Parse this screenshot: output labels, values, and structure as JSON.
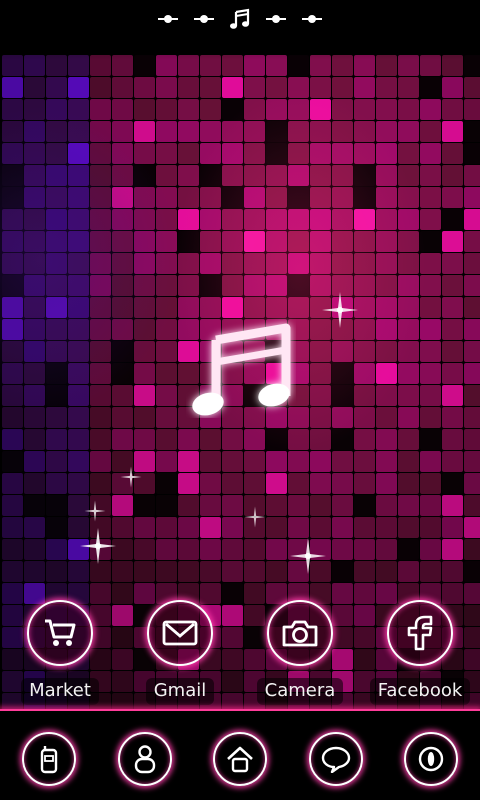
{
  "theme": {
    "accent": "#ff3c9a",
    "glow": "#ff5fc0",
    "icon_stroke": "#ffffff",
    "background": "#000000"
  },
  "page_indicator": {
    "pages": [
      "dot",
      "dot",
      "music-note",
      "dot",
      "dot"
    ],
    "current_page": 3
  },
  "wallpaper": {
    "center_icon": "music-note-icon"
  },
  "apps": [
    {
      "label": "Market",
      "icon": "shopping-cart-icon"
    },
    {
      "label": "Gmail",
      "icon": "envelope-icon"
    },
    {
      "label": "Camera",
      "icon": "camera-icon"
    },
    {
      "label": "Facebook",
      "icon": "facebook-icon"
    }
  ],
  "dock": [
    {
      "icon": "phone-icon"
    },
    {
      "icon": "contacts-icon"
    },
    {
      "icon": "home-icon"
    },
    {
      "icon": "messaging-icon"
    },
    {
      "icon": "browser-icon"
    }
  ]
}
